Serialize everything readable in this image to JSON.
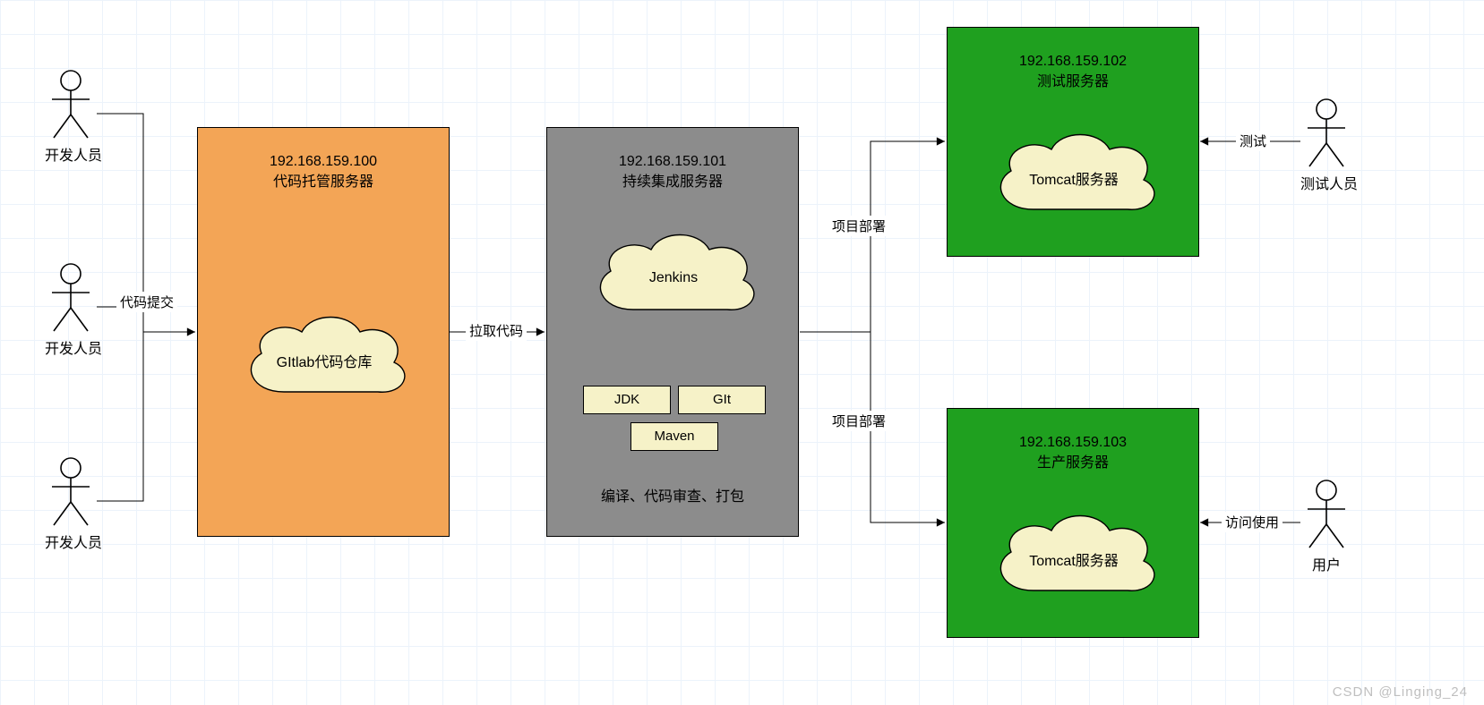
{
  "actors": {
    "dev1": "开发人员",
    "dev2": "开发人员",
    "dev3": "开发人员",
    "tester": "测试人员",
    "user": "用户"
  },
  "servers": {
    "code": {
      "ip": "192.168.159.100",
      "name": "代码托管服务器",
      "cloud": "GItlab代码仓库"
    },
    "ci": {
      "ip": "192.168.159.101",
      "name": "持续集成服务器",
      "cloud": "Jenkins",
      "tools": {
        "jdk": "JDK",
        "git": "GIt",
        "maven": "Maven"
      },
      "caption": "编译、代码审查、打包"
    },
    "test": {
      "ip": "192.168.159.102",
      "name": "测试服务器",
      "cloud": "Tomcat服务器"
    },
    "prod": {
      "ip": "192.168.159.103",
      "name": "生产服务器",
      "cloud": "Tomcat服务器"
    }
  },
  "edges": {
    "commit": "代码提交",
    "pull": "拉取代码",
    "deploy_test": "项目部署",
    "deploy_prod": "项目部署",
    "do_test": "测试",
    "use": "访问使用"
  },
  "watermark": "CSDN @Linging_24"
}
